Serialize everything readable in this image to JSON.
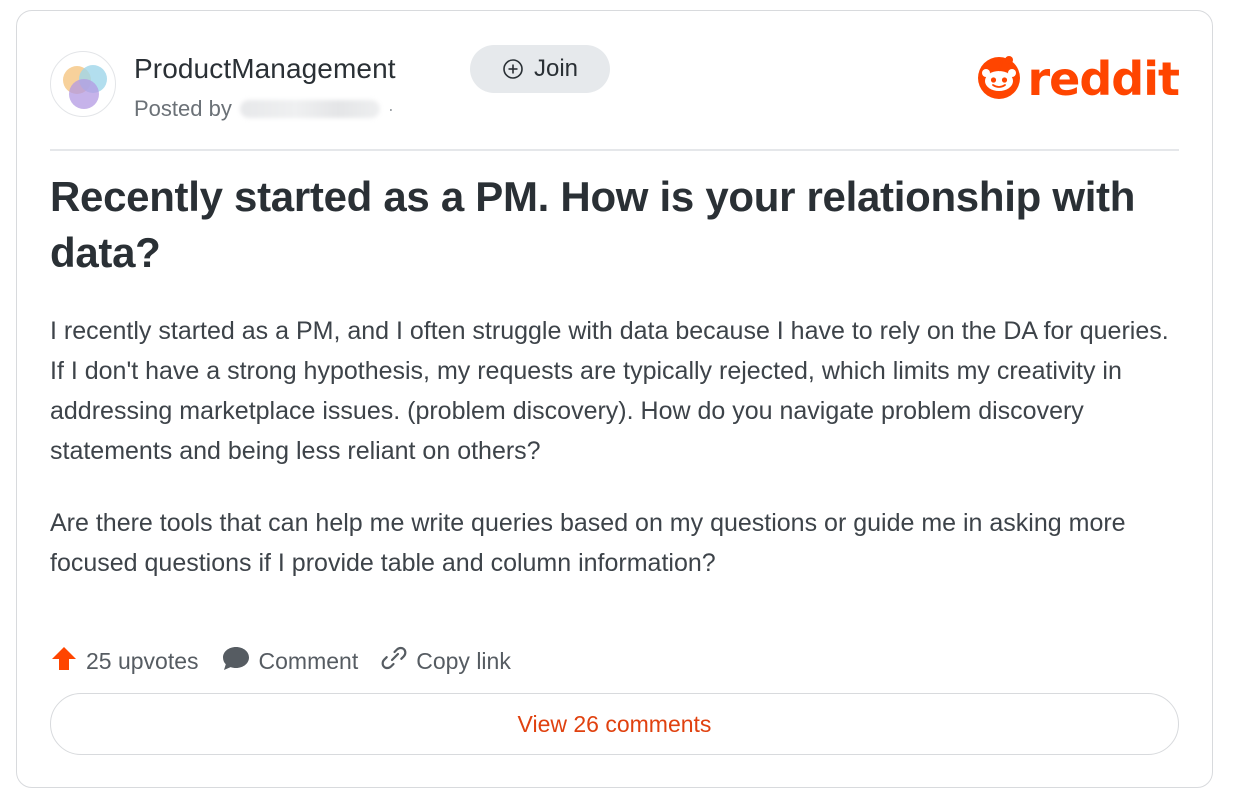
{
  "post": {
    "subreddit": "ProductManagement",
    "join_label": "Join",
    "posted_by_label": "Posted by",
    "posted_by_separator": "·",
    "brand": {
      "wordmark": "reddit",
      "color": "#ff4500",
      "icon": "reddit-snoo-icon"
    },
    "title": "Recently started as a PM. How is your relationship with data?",
    "body": [
      "I recently started as a PM, and I often struggle with data because I have to rely on the DA for queries. If I don't have a strong hypothesis, my requests are typically rejected, which limits my creativity in addressing marketplace issues. (problem discovery). How do you navigate problem discovery statements and being less reliant on others?",
      "Are there tools that can help me write queries based on my questions or guide me in asking more focused questions if I provide table and column information?"
    ],
    "actions": {
      "upvotes_label": "25 upvotes",
      "comment_label": "Comment",
      "copy_link_label": "Copy link"
    },
    "view_comments_label": "View 26 comments"
  },
  "colors": {
    "accent": "#ff4500",
    "link_red": "#e0410f",
    "title": "#2a3035",
    "body": "#3d4349",
    "muted": "#6b7177"
  }
}
